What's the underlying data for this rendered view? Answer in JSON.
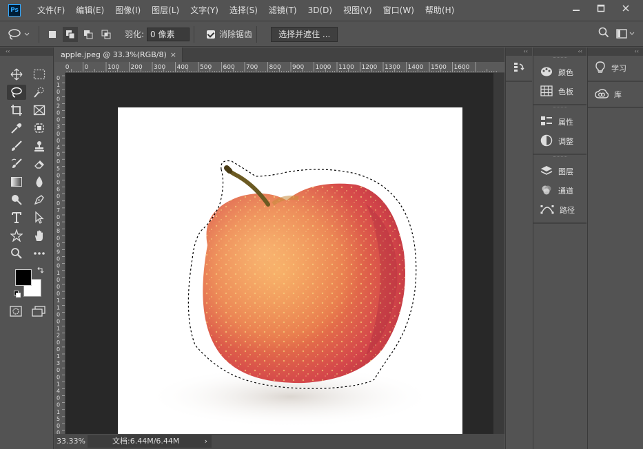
{
  "app": {
    "logo": "Ps",
    "menu": [
      "文件(F)",
      "编辑(E)",
      "图像(I)",
      "图层(L)",
      "文字(Y)",
      "选择(S)",
      "滤镜(T)",
      "3D(D)",
      "视图(V)",
      "窗口(W)",
      "帮助(H)"
    ],
    "window_controls": [
      "minimize-icon",
      "maximize-icon",
      "close-icon"
    ]
  },
  "options": {
    "feather_label": "羽化:",
    "feather_value": "0 像素",
    "antialias_label": "消除锯齿",
    "antialias_checked": true,
    "select_mask_label": "选择并遮住 ..."
  },
  "document": {
    "tab_title": "apple.jpeg @ 33.3%(RGB/8)",
    "tab_close": "×",
    "zoom": "33.33%",
    "doc_size": "文档:6.44M/6.44M",
    "status_arrow": "›",
    "ruler_h_ticks": [
      "00",
      "0",
      "100",
      "200",
      "300",
      "400",
      "500",
      "600",
      "700",
      "800",
      "900",
      "1000",
      "1100",
      "1200",
      "1300",
      "1400",
      "1500",
      "1600"
    ],
    "ruler_v_ticks": [
      "0",
      "1",
      "0",
      "0",
      "2",
      "0",
      "0",
      "3",
      "0",
      "0",
      "4",
      "0",
      "0",
      "5",
      "0",
      "0",
      "6",
      "0",
      "0",
      "7",
      "0",
      "0",
      "8",
      "0",
      "0",
      "9",
      "0",
      "0",
      "1",
      "0",
      "0",
      "0",
      "1",
      "1",
      "0",
      "0",
      "1",
      "2",
      "0",
      "0",
      "1",
      "3",
      "0",
      "0",
      "1",
      "4",
      "0",
      "0",
      "1",
      "5",
      "0",
      "0"
    ]
  },
  "tools": [
    {
      "name": "move-tool",
      "icon": "move-icon"
    },
    {
      "name": "marquee-tool",
      "icon": "marquee-icon"
    },
    {
      "name": "lasso-tool",
      "icon": "lasso-icon",
      "selected": true
    },
    {
      "name": "quick-select-tool",
      "icon": "quick-select-icon"
    },
    {
      "name": "crop-tool",
      "icon": "crop-icon"
    },
    {
      "name": "frame-tool",
      "icon": "frame-icon"
    },
    {
      "name": "eyedropper-tool",
      "icon": "eyedropper-icon"
    },
    {
      "name": "spot-heal-tool",
      "icon": "spot-heal-icon"
    },
    {
      "name": "brush-tool",
      "icon": "brush-icon"
    },
    {
      "name": "clone-stamp-tool",
      "icon": "stamp-icon"
    },
    {
      "name": "history-brush-tool",
      "icon": "history-brush-icon"
    },
    {
      "name": "eraser-tool",
      "icon": "eraser-icon"
    },
    {
      "name": "gradient-tool",
      "icon": "gradient-icon"
    },
    {
      "name": "blur-tool",
      "icon": "blur-icon"
    },
    {
      "name": "dodge-tool",
      "icon": "dodge-icon"
    },
    {
      "name": "pen-tool",
      "icon": "pen-icon"
    },
    {
      "name": "type-tool",
      "icon": "type-icon"
    },
    {
      "name": "path-select-tool",
      "icon": "path-select-icon"
    },
    {
      "name": "shape-tool",
      "icon": "shape-icon"
    },
    {
      "name": "hand-tool",
      "icon": "hand-icon"
    },
    {
      "name": "zoom-tool",
      "icon": "zoom-icon"
    },
    {
      "name": "more-tools",
      "icon": "more-icon"
    }
  ],
  "panels": {
    "col1": [
      {
        "icon": "history-icon"
      }
    ],
    "col2_groups": [
      [
        {
          "icon": "palette-icon",
          "label": "颜色"
        },
        {
          "icon": "grid-icon",
          "label": "色板"
        }
      ],
      [
        {
          "icon": "properties-icon",
          "label": "属性"
        },
        {
          "icon": "adjust-icon",
          "label": "调整"
        }
      ],
      [
        {
          "icon": "layers-icon",
          "label": "图层"
        },
        {
          "icon": "channels-icon",
          "label": "通道"
        },
        {
          "icon": "paths-icon",
          "label": "路径"
        }
      ]
    ],
    "col3": [
      {
        "icon": "bulb-icon",
        "label": "学习"
      },
      {
        "icon": "cc-library-icon",
        "label": "库"
      }
    ],
    "collapse": "‹‹"
  },
  "colors": {
    "foreground": "#000000",
    "background": "#ffffff",
    "accent": "#31a8ff"
  }
}
